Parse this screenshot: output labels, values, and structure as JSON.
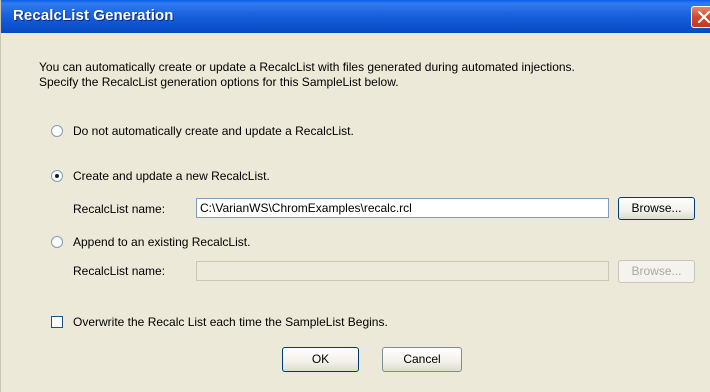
{
  "window": {
    "title": "RecalcList Generation"
  },
  "intro": {
    "line1": "You can automatically create or update a RecalcList with files generated during automated injections.",
    "line2": "Specify the RecalcList generation options for this SampleList below."
  },
  "options": {
    "no_create": {
      "label": "Do not automatically create and update a RecalcList.",
      "selected": false
    },
    "create_new": {
      "label": "Create and update a new RecalcList.",
      "selected": true,
      "name_label": "RecalcList name:",
      "name_value": "C:\\VarianWS\\ChromExamples\\recalc.rcl",
      "browse_label": "Browse..."
    },
    "append": {
      "label": "Append to an existing RecalcList.",
      "selected": false,
      "name_label": "RecalcList name:",
      "name_value": "",
      "browse_label": "Browse..."
    }
  },
  "overwrite": {
    "label": "Overwrite the Recalc List each time the SampleList Begins.",
    "checked": false
  },
  "buttons": {
    "ok": "OK",
    "cancel": "Cancel"
  }
}
